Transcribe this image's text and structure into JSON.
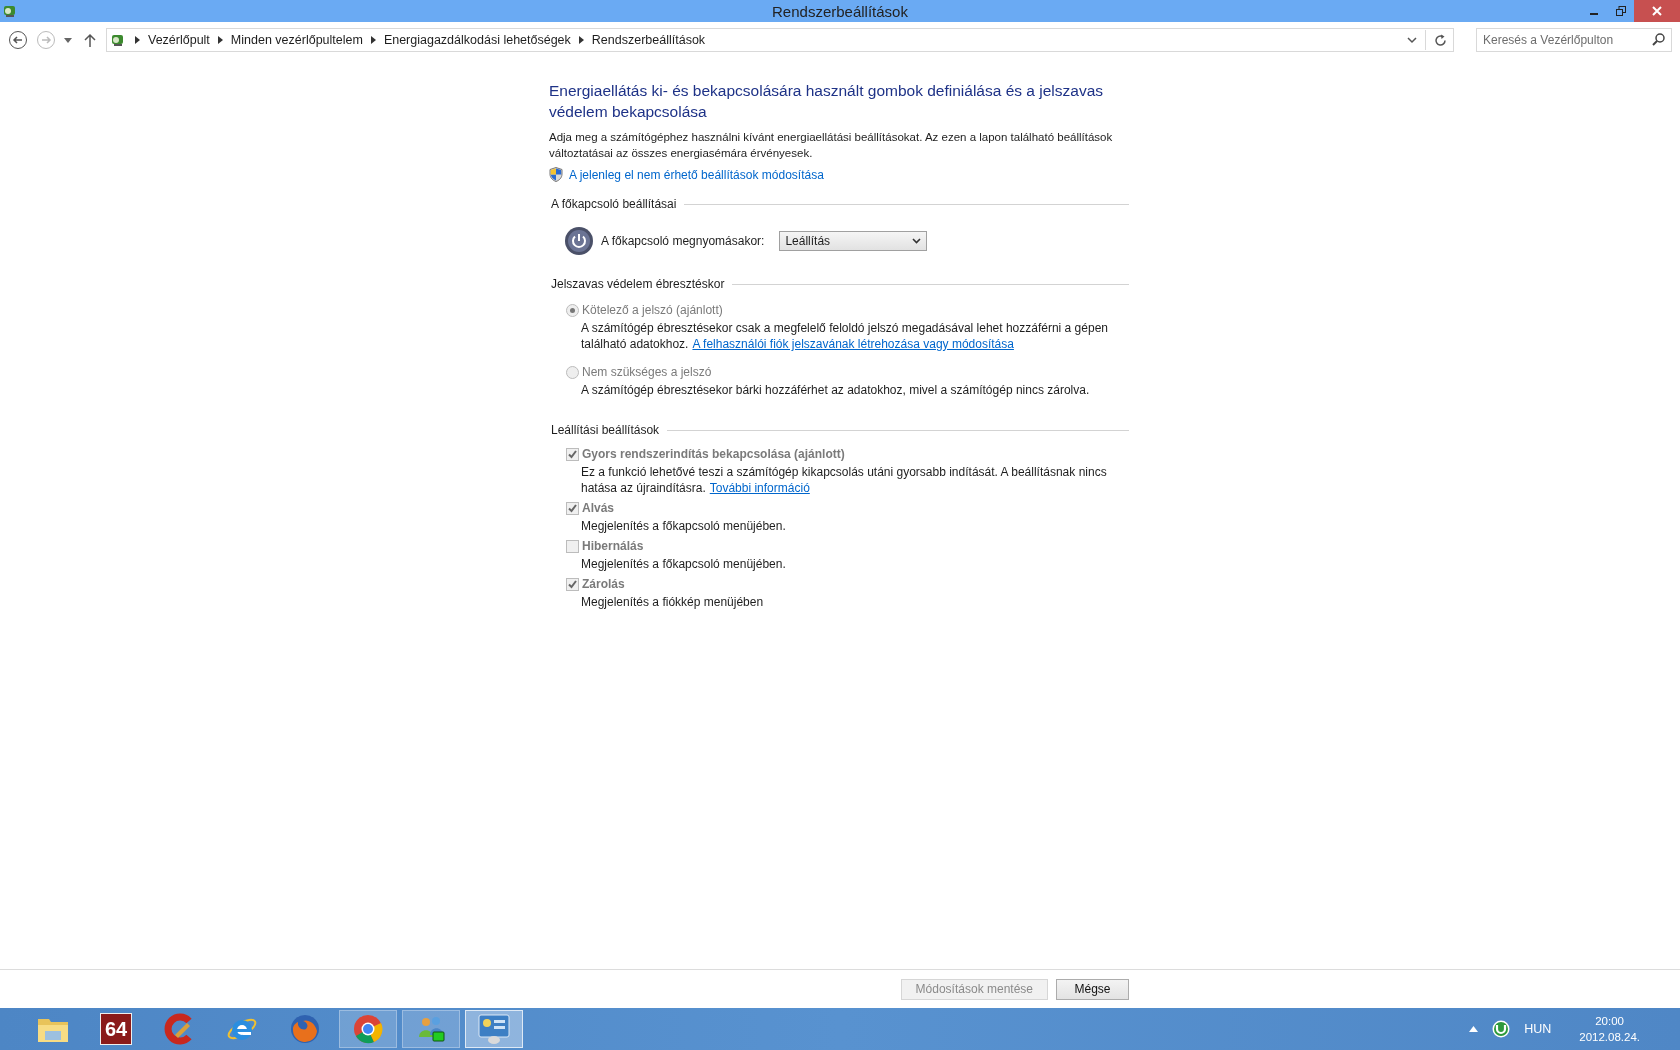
{
  "window": {
    "title": "Rendszerbeállítások"
  },
  "nav": {
    "breadcrumb": [
      "Vezérlőpult",
      "Minden vezérlőpultelem",
      "Energiagazdálkodási lehetőségek",
      "Rendszerbeállítások"
    ],
    "search": {
      "placeholder": "Keresés a Vezérlőpulton"
    }
  },
  "page": {
    "heading": "Energiaellátás ki- és bekapcsolására használt gombok definiálása és a jelszavas védelem bekapcsolása",
    "description": "Adja meg a számítógéphez használni kívánt energiaellátási beállításokat. Az ezen a lapon található beállítások változtatásai az összes energiasémára érvényesek.",
    "admin_link": "A jelenleg el nem érhető beállítások módosítása",
    "sections": [
      {
        "kind": "power",
        "title": "A főkapcsoló beállításai",
        "label": "A főkapcsoló megnyomásakor:",
        "value": "Leállítás"
      },
      {
        "kind": "radios",
        "title": "Jelszavas védelem ébresztéskor",
        "items": [
          {
            "label": "Kötelező a jelszó (ajánlott)",
            "selected": true,
            "disabled": true,
            "description": "A számítógép ébresztésekor csak a megfelelő feloldó jelszó megadásával lehet hozzáférni a gépen található adatokhoz.",
            "link": "A felhasználói fiók jelszavának létrehozása vagy módosítása"
          },
          {
            "label": "Nem szükséges a jelszó",
            "selected": false,
            "disabled": true,
            "description": "A számítógép ébresztésekor bárki hozzáférhet az adatokhoz, mivel a számítógép nincs zárolva."
          }
        ]
      },
      {
        "kind": "checks",
        "title": "Leállítási beállítások",
        "items": [
          {
            "label": "Gyors rendszerindítás bekapcsolása (ajánlott)",
            "checked": true,
            "disabled": true,
            "description": "Ez a funkció lehetővé teszi a számítógép kikapcsolás utáni gyorsabb indítását. A beállításnak nincs hatása az újraindításra.",
            "link": "További információ"
          },
          {
            "label": "Alvás",
            "checked": true,
            "disabled": true,
            "description": "Megjelenítés a főkapcsoló menüjében."
          },
          {
            "label": "Hibernálás",
            "checked": false,
            "disabled": true,
            "description": "Megjelenítés a főkapcsoló menüjében."
          },
          {
            "label": "Zárolás",
            "checked": true,
            "disabled": true,
            "description": "Megjelenítés a fiókkép menüjében"
          }
        ]
      }
    ]
  },
  "footer": {
    "buttons": [
      {
        "label": "Módosítások mentése",
        "disabled": true
      },
      {
        "label": "Mégse",
        "disabled": false
      }
    ]
  },
  "taskbar": {
    "apps": [
      {
        "kind": "folder",
        "running": false,
        "active": false
      },
      {
        "kind": "number",
        "label": "64",
        "running": false,
        "active": false
      },
      {
        "kind": "cleaner",
        "running": false,
        "active": false
      },
      {
        "kind": "ie",
        "running": false,
        "active": false
      },
      {
        "kind": "firefox",
        "running": false,
        "active": false
      },
      {
        "kind": "chrome",
        "running": true,
        "active": false
      },
      {
        "kind": "people",
        "running": true,
        "active": false
      },
      {
        "kind": "panel",
        "running": true,
        "active": true
      }
    ],
    "language": "HUN",
    "time": "20:00",
    "date": "2012.08.24."
  }
}
